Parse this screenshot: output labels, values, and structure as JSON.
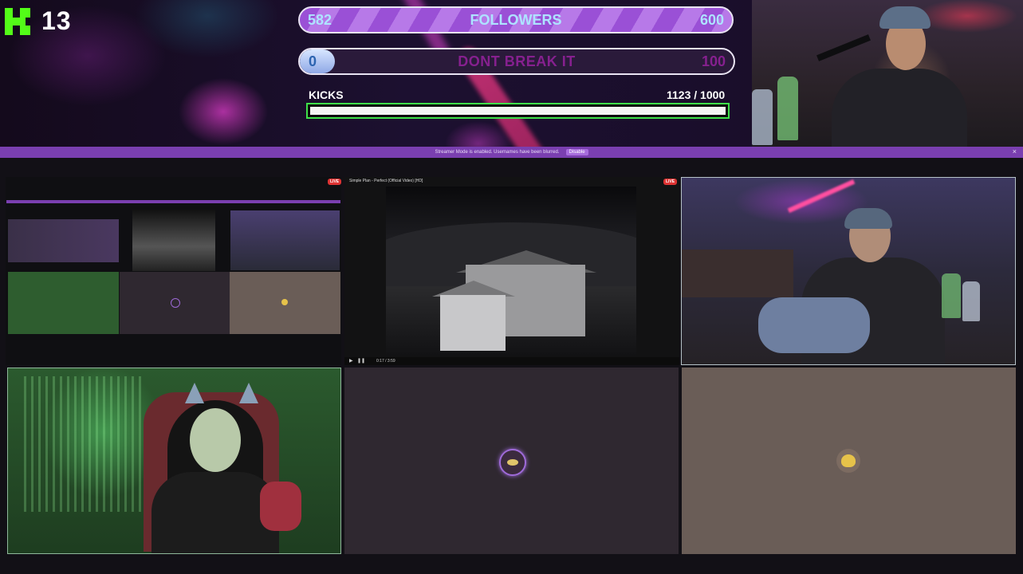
{
  "overlay": {
    "platform_logo": "kick-logo",
    "viewer_count": "13",
    "followers_bar": {
      "current": "582",
      "label": "FOLLOWERS",
      "goal": "600",
      "progress": 0.97
    },
    "dont_break_bar": {
      "current": "0",
      "label": "DONT BREAK IT",
      "goal": "100",
      "progress": 0.0
    },
    "kicks": {
      "label": "KICKS",
      "count": "1123 / 1000",
      "progress": 1.0
    }
  },
  "banner": {
    "message": "Streamer Mode is enabled. Usernames have been blurred.",
    "button_label": "Disable",
    "close_icon": "close-icon"
  },
  "tiles": {
    "video": {
      "title": "Simple Plan - Perfect (Official Video) [HD]",
      "live": "LIVE",
      "time": "0:17 / 3:59",
      "progress": 0.07
    },
    "mini": {
      "live": "LIVE"
    },
    "empty1_icon": "eye-icon",
    "empty2_icon": "chick-icon"
  },
  "colors": {
    "kick_green": "#53fc18",
    "purple": "#7a3fb0",
    "followers_stripe": "#9a50d6"
  }
}
